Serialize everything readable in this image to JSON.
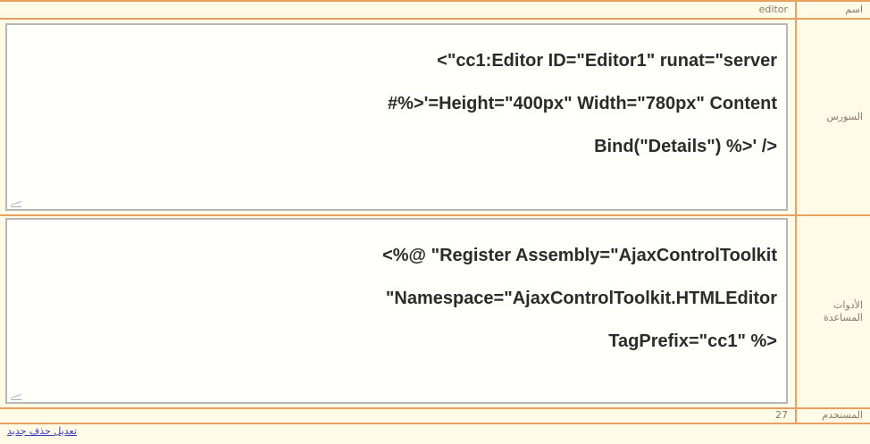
{
  "rows": {
    "name": {
      "label": "اسم",
      "value": "editor"
    },
    "source": {
      "label": "السورس",
      "code_lines": [
        "cc1:Editor ID=\"Editor1\" runat=\"server\">",
        "Height=\"400px\" Width=\"780px\" Content='<%#",
        "</ '<% (\"Bind(\"Details"
      ]
    },
    "tools": {
      "label": "الأدوات المساعدة",
      "code_lines": [
        "Register Assembly=\"AjaxControlToolkit\" @%>",
        "Namespace=\"AjaxControlToolkit.HTMLEditor\"",
        "<% \"TagPrefix=\"cc1"
      ]
    },
    "user": {
      "label": "المستخدم",
      "value": "27"
    }
  },
  "footer": {
    "links": "تعديل حذف جديد"
  }
}
